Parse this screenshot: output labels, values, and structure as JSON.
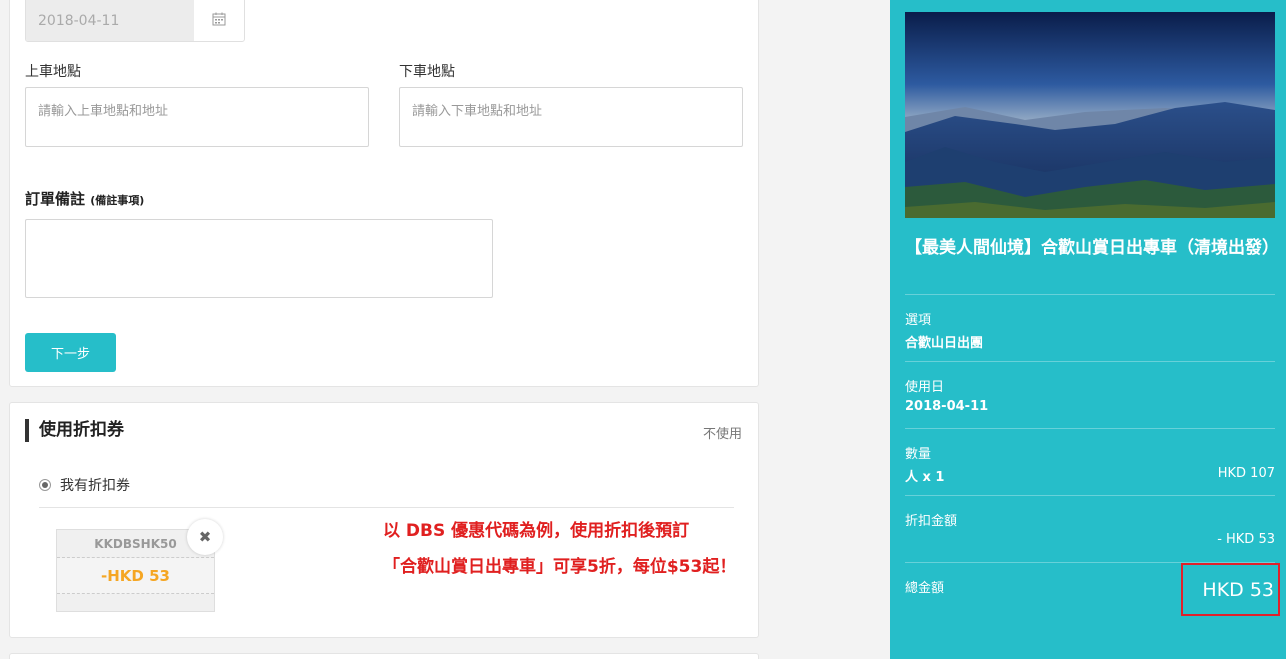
{
  "form": {
    "date_value": "2018-04-11",
    "pickup_label": "上車地點",
    "pickup_placeholder": "請輸入上車地點和地址",
    "dropoff_label": "下車地點",
    "dropoff_placeholder": "請輸入下車地點和地址",
    "remark_label": "訂單備註",
    "remark_hint": "(備註事項)",
    "next_button": "下一步"
  },
  "coupon": {
    "title": "使用折扣券",
    "no_use": "不使用",
    "radio_label": "我有折扣券",
    "code": "KKDBSHK50",
    "amount": "-HKD 53"
  },
  "annotation": {
    "line1": "以 DBS 優惠代碼為例，使用折扣後預訂",
    "line2": "「合歡山賞日出專車」可享5折，每位$53起！"
  },
  "summary": {
    "title": "【最美人間仙境】合歡山賞日出專車（清境出發）",
    "option_label": "選項",
    "option_value": "合歡山日出團",
    "date_label": "使用日",
    "date_value": "2018-04-11",
    "qty_label": "數量",
    "qty_value": "人 x 1",
    "qty_price": "HKD 107",
    "discount_label": "折扣金額",
    "discount_value": "- HKD 53",
    "total_label": "總金額",
    "total_value": "HKD 53"
  },
  "colors": {
    "accent": "#26bec9",
    "coupon_amount": "#f5a623",
    "annotation": "#e02020"
  }
}
